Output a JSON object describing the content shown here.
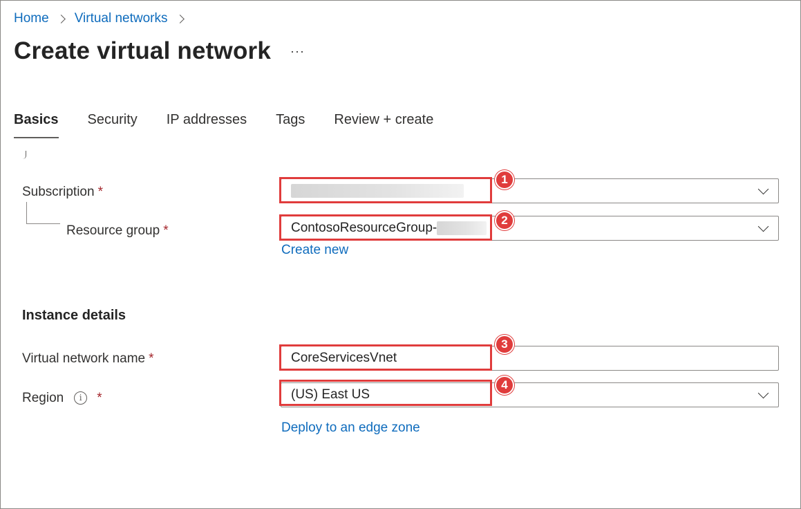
{
  "breadcrumb": {
    "items": [
      "Home",
      "Virtual networks"
    ]
  },
  "page": {
    "title": "Create virtual network",
    "more_label": "···"
  },
  "tabs": [
    {
      "label": "Basics",
      "active": true
    },
    {
      "label": "Security"
    },
    {
      "label": "IP addresses"
    },
    {
      "label": "Tags"
    },
    {
      "label": "Review + create"
    }
  ],
  "project": {
    "subscription_label": "Subscription",
    "resource_group_label": "Resource group",
    "resource_group_value": "ContosoResourceGroup-",
    "create_new_link": "Create new"
  },
  "instance": {
    "heading": "Instance details",
    "vnet_name_label": "Virtual network name",
    "vnet_name_value": "CoreServicesVnet",
    "region_label": "Region",
    "region_value": "(US) East US",
    "edge_zone_link": "Deploy to an edge zone"
  },
  "required_marker": "*",
  "info_icon_glyph": "i",
  "callouts": [
    "1",
    "2",
    "3",
    "4"
  ],
  "colors": {
    "link": "#0f6cbd",
    "required": "#a4262c",
    "callout": "#e03c3c"
  },
  "icons": [
    "chevron-right-icon",
    "chevron-down-icon",
    "info-icon",
    "more-options-icon"
  ]
}
